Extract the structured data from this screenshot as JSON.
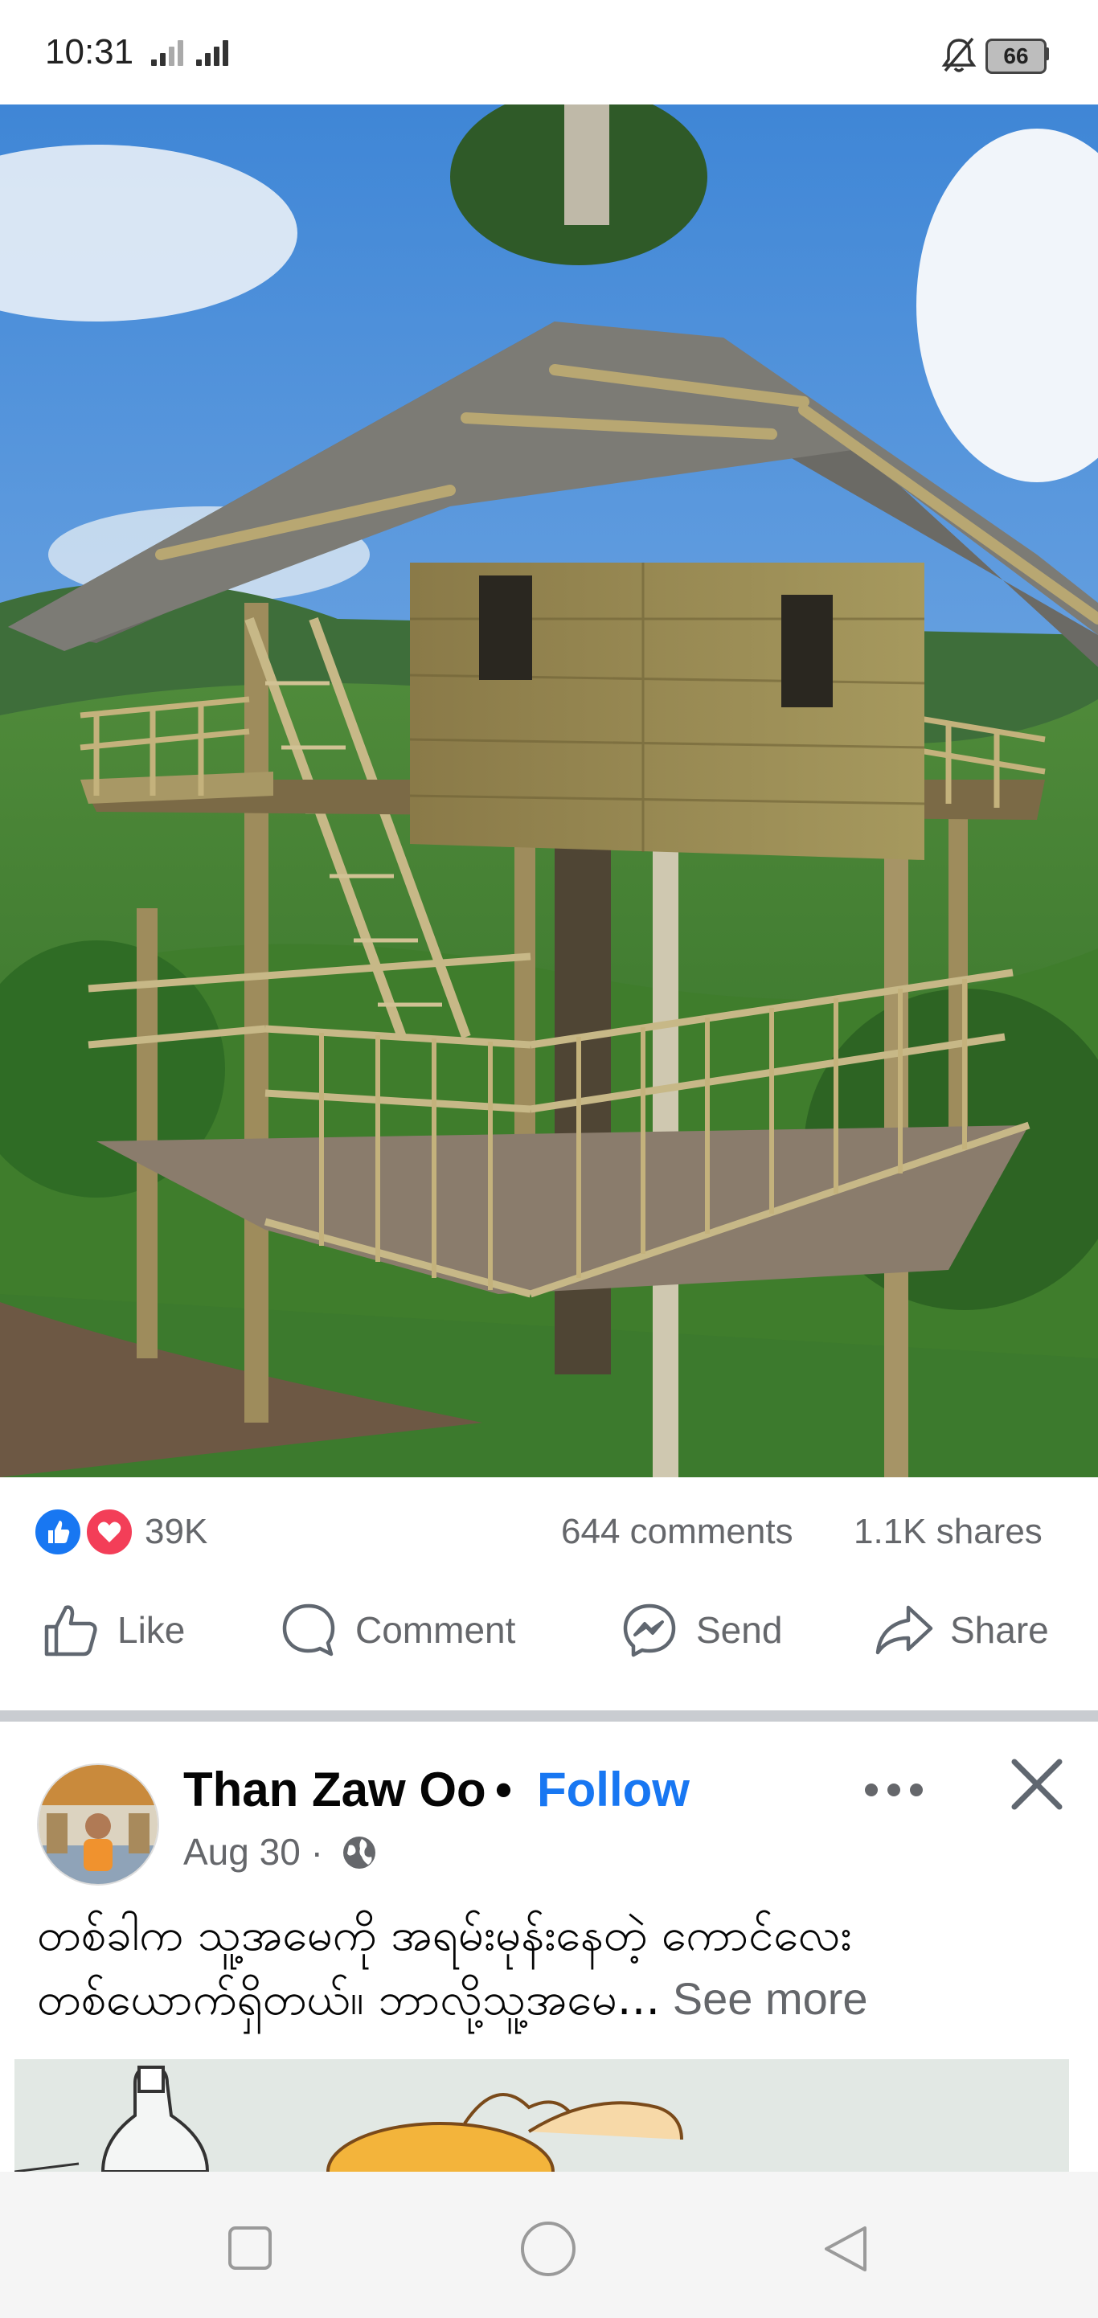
{
  "status_bar": {
    "time": "10:31",
    "battery": "66",
    "icons": [
      "signal-icon",
      "signal-icon",
      "mute-bell-icon",
      "battery-icon"
    ]
  },
  "post": {
    "image_alt": "bamboo tree house",
    "reactions": {
      "icons": [
        "like-reaction-icon",
        "love-reaction-icon"
      ],
      "count": "39K",
      "colors": {
        "like": "#1877f2",
        "love": "#f33e58"
      }
    },
    "comments": "644 comments",
    "shares": "1.1K shares",
    "actions": [
      {
        "label": "Like",
        "icon": "thumbs-up-icon"
      },
      {
        "label": "Comment",
        "icon": "comment-icon"
      },
      {
        "label": "Send",
        "icon": "messenger-icon"
      },
      {
        "label": "Share",
        "icon": "share-icon"
      }
    ]
  },
  "next_post": {
    "author": "Than Zaw Oo",
    "separator": "•",
    "follow_label": "Follow",
    "date": "Aug 30 ·",
    "text_line1": "တစ်ခါက သူ့အမေကို အရမ်းမုန်းနေတဲ့ ကောင်လေး",
    "text_line2": "တစ်ယောက်ရှိတယ်။ ဘာလို့သူ့အမေ...",
    "see_more": " See more",
    "accent_color": "#1877f2"
  }
}
